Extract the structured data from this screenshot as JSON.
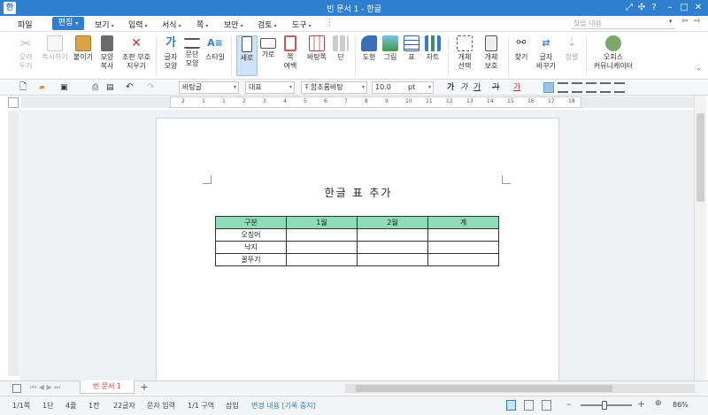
{
  "window": {
    "title": "빈 문서 1 - 한글",
    "logo": "한"
  },
  "menu": {
    "items": [
      "파일",
      "편집",
      "보기",
      "입력",
      "서식",
      "쪽",
      "보안",
      "검토",
      "도구"
    ],
    "search_placeholder": "찾을 내용"
  },
  "ribbon": {
    "groups": [
      [
        "오려\n두기",
        "복사하기",
        "붙이기",
        "모양\n복사",
        "조판 부호\n지우기"
      ],
      [
        "글자\n모양",
        "문단\n모양",
        "스타일"
      ],
      [
        "세로",
        "가로",
        "쪽\n여백",
        "바탕쪽",
        "단"
      ],
      [
        "도형",
        "그림",
        "표",
        "차트"
      ],
      [
        "개체\n선택",
        "개체\n보호"
      ],
      [
        "찾기",
        "글자\n바꾸기",
        "정렬"
      ],
      [
        "오피스\n커뮤니케이터"
      ]
    ]
  },
  "format": {
    "style": "바탕글",
    "para": "대표",
    "font": "함초롬바탕",
    "size": "10.0",
    "unit": "pt"
  },
  "document": {
    "title": "한글 표 추가",
    "table": {
      "header": [
        "구분",
        "1월",
        "2월",
        "계"
      ],
      "rows": [
        [
          "오징어",
          "",
          "",
          ""
        ],
        [
          "낙지",
          "",
          "",
          ""
        ],
        [
          "꼴뚜기",
          "",
          "",
          ""
        ]
      ]
    }
  },
  "tabs": {
    "doc_tab": "빈 문서 1",
    "add": "+"
  },
  "status": {
    "page": "1/1쪽",
    "section": "1단",
    "line": "4줄",
    "column": "1칸",
    "chars": "22글자",
    "input_mode": "문자 입력",
    "zone": "1/1 구역",
    "insert": "삽입",
    "track": "변경 내용 [기록 중지]",
    "zoom": "86%"
  },
  "ruler": [
    "2",
    "1",
    "1",
    "2",
    "3",
    "4",
    "5",
    "6",
    "7",
    "8",
    "9",
    "10",
    "11",
    "12",
    "13",
    "14",
    "15",
    "16",
    "17",
    "18"
  ],
  "colors": {
    "accent": "#2f7fcf",
    "table_header": "#8edcb8",
    "tab_text": "#d04040"
  }
}
